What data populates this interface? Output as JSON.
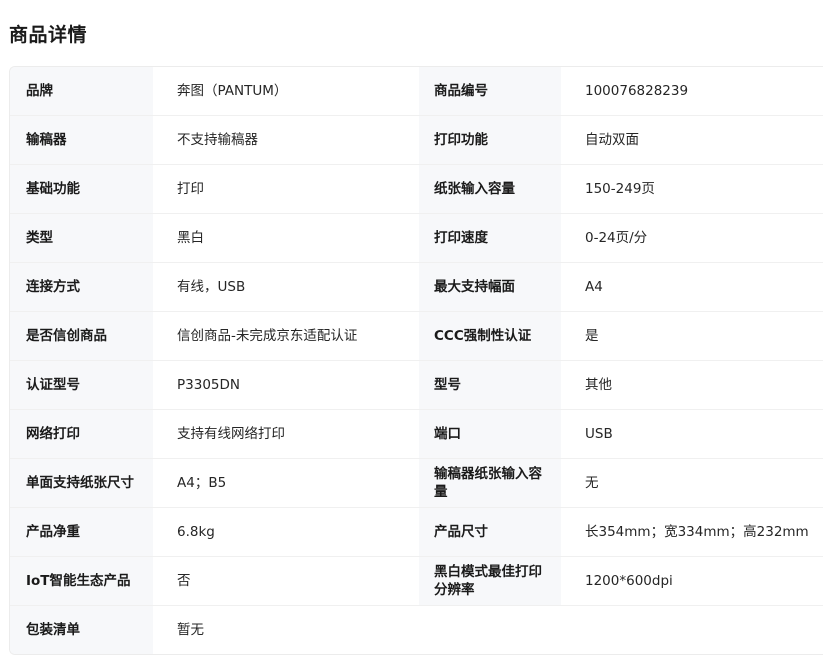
{
  "page_title": "商品详情",
  "rows": [
    {
      "k1": "品牌",
      "v1": "奔图（PANTUM）",
      "k2": "商品编号",
      "v2": "100076828239"
    },
    {
      "k1": "输稿器",
      "v1": "不支持输稿器",
      "k2": "打印功能",
      "v2": "自动双面"
    },
    {
      "k1": "基础功能",
      "v1": "打印",
      "k2": "纸张输入容量",
      "v2": "150-249页"
    },
    {
      "k1": "类型",
      "v1": "黑白",
      "k2": "打印速度",
      "v2": "0-24页/分"
    },
    {
      "k1": "连接方式",
      "v1": "有线，USB",
      "k2": "最大支持幅面",
      "v2": "A4"
    },
    {
      "k1": "是否信创商品",
      "v1": "信创商品-未完成京东适配认证",
      "k2": "CCC强制性认证",
      "v2": "是"
    },
    {
      "k1": "认证型号",
      "v1": "P3305DN",
      "k2": "型号",
      "v2": "其他"
    },
    {
      "k1": "网络打印",
      "v1": "支持有线网络打印",
      "k2": "端口",
      "v2": "USB"
    },
    {
      "k1": "单面支持纸张尺寸",
      "v1": "A4；B5",
      "k2": "输稿器纸张输入容量",
      "v2": "无"
    },
    {
      "k1": "产品净重",
      "v1": "6.8kg",
      "k2": "产品尺寸",
      "v2": "长354mm；宽334mm；高232mm"
    },
    {
      "k1": "IoT智能生态产品",
      "v1": "否",
      "k2": "黑白模式最佳打印分辨率",
      "v2": "1200*600dpi"
    },
    {
      "k1": "包装清单",
      "v1": "暂无"
    }
  ]
}
